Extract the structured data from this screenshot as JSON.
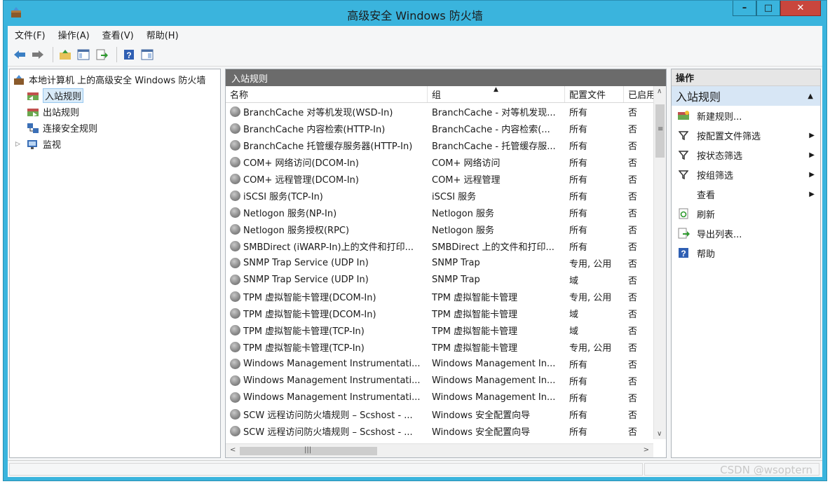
{
  "window": {
    "title": "高级安全 Windows 防火墙",
    "minimize_glyph": "–",
    "maximize_glyph": "□",
    "close_glyph": "✕"
  },
  "menu": [
    "文件(F)",
    "操作(A)",
    "查看(V)",
    "帮助(H)"
  ],
  "tree": {
    "root": "本地计算机 上的高级安全 Windows 防火墙",
    "items": [
      "入站规则",
      "出站规则",
      "连接安全规则",
      "监视"
    ],
    "selected": "入站规则"
  },
  "center": {
    "header": "入站规则",
    "columns": [
      "名称",
      "组",
      "配置文件",
      "已启用"
    ],
    "rows": [
      [
        "BranchCache 对等机发现(WSD-In)",
        "BranchCache - 对等机发现...",
        "所有",
        "否"
      ],
      [
        "BranchCache 内容检索(HTTP-In)",
        "BranchCache - 内容检索(...",
        "所有",
        "否"
      ],
      [
        "BranchCache 托管缓存服务器(HTTP-In)",
        "BranchCache - 托管缓存服...",
        "所有",
        "否"
      ],
      [
        "COM+ 网络访问(DCOM-In)",
        "COM+ 网络访问",
        "所有",
        "否"
      ],
      [
        "COM+ 远程管理(DCOM-In)",
        "COM+ 远程管理",
        "所有",
        "否"
      ],
      [
        "iSCSI 服务(TCP-In)",
        "iSCSI 服务",
        "所有",
        "否"
      ],
      [
        "Netlogon 服务(NP-In)",
        "Netlogon 服务",
        "所有",
        "否"
      ],
      [
        "Netlogon 服务授权(RPC)",
        "Netlogon 服务",
        "所有",
        "否"
      ],
      [
        "SMBDirect (iWARP-In)上的文件和打印...",
        "SMBDirect 上的文件和打印...",
        "所有",
        "否"
      ],
      [
        "SNMP Trap Service (UDP In)",
        "SNMP Trap",
        "专用, 公用",
        "否"
      ],
      [
        "SNMP Trap Service (UDP In)",
        "SNMP Trap",
        "域",
        "否"
      ],
      [
        "TPM 虚拟智能卡管理(DCOM-In)",
        "TPM 虚拟智能卡管理",
        "专用, 公用",
        "否"
      ],
      [
        "TPM 虚拟智能卡管理(DCOM-In)",
        "TPM 虚拟智能卡管理",
        "域",
        "否"
      ],
      [
        "TPM 虚拟智能卡管理(TCP-In)",
        "TPM 虚拟智能卡管理",
        "域",
        "否"
      ],
      [
        "TPM 虚拟智能卡管理(TCP-In)",
        "TPM 虚拟智能卡管理",
        "专用, 公用",
        "否"
      ],
      [
        "Windows Management Instrumentati...",
        "Windows Management In...",
        "所有",
        "否"
      ],
      [
        "Windows Management Instrumentati...",
        "Windows Management In...",
        "所有",
        "否"
      ],
      [
        "Windows Management Instrumentati...",
        "Windows Management In...",
        "所有",
        "否"
      ],
      [
        "SCW 远程访问防火墙规则 – Scshost - ...",
        "Windows 安全配置向导",
        "所有",
        "否"
      ],
      [
        "SCW 远程访问防火墙规则 – Scshost - ...",
        "Windows 安全配置向导",
        "所有",
        "否"
      ]
    ]
  },
  "actions": {
    "header": "操作",
    "section": "入站规则",
    "items": [
      {
        "label": "新建规则...",
        "icon": "new-rule-icon",
        "submenu": false
      },
      {
        "label": "按配置文件筛选",
        "icon": "filter-icon",
        "submenu": true
      },
      {
        "label": "按状态筛选",
        "icon": "filter-icon",
        "submenu": true
      },
      {
        "label": "按组筛选",
        "icon": "filter-icon",
        "submenu": true
      },
      {
        "label": "查看",
        "icon": "",
        "submenu": true
      },
      {
        "label": "刷新",
        "icon": "refresh-icon",
        "submenu": false
      },
      {
        "label": "导出列表...",
        "icon": "export-icon",
        "submenu": false
      },
      {
        "label": "帮助",
        "icon": "help-icon",
        "submenu": false
      }
    ]
  },
  "watermark": "CSDN @wsoptern"
}
